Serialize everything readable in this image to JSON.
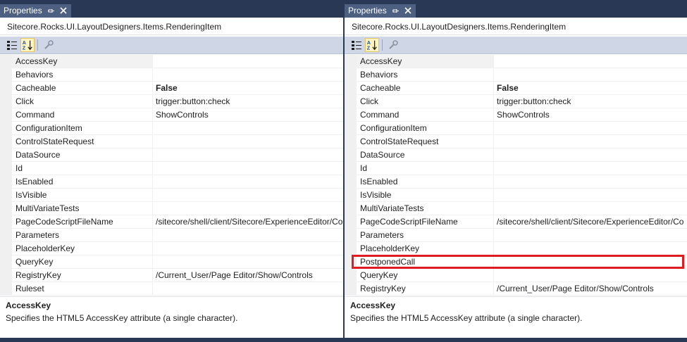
{
  "panel_title": "Properties",
  "object_name": "Sitecore.Rocks.UI.LayoutDesigners.Items.RenderingItem",
  "colors": {
    "window_bg": "#293955",
    "tab_bg": "#4d6082",
    "toolbar_bg": "#cfd6e5",
    "highlight": "#e01b24"
  },
  "icons": {
    "categorized": "categorized-icon",
    "alphabetical": "alphabetical-icon",
    "property_pages": "wrench-icon",
    "pin": "pin-icon",
    "close": "close-icon"
  },
  "left": {
    "rows": [
      {
        "name": "AccessKey",
        "value": ""
      },
      {
        "name": "Behaviors",
        "value": ""
      },
      {
        "name": "Cacheable",
        "value": "False"
      },
      {
        "name": "Click",
        "value": "trigger:button:check"
      },
      {
        "name": "Command",
        "value": "ShowControls"
      },
      {
        "name": "ConfigurationItem",
        "value": ""
      },
      {
        "name": "ControlStateRequest",
        "value": ""
      },
      {
        "name": "DataSource",
        "value": ""
      },
      {
        "name": "Id",
        "value": ""
      },
      {
        "name": "IsEnabled",
        "value": ""
      },
      {
        "name": "IsVisible",
        "value": ""
      },
      {
        "name": "MultiVariateTests",
        "value": ""
      },
      {
        "name": "PageCodeScriptFileName",
        "value": "/sitecore/shell/client/Sitecore/ExperienceEditor/Co"
      },
      {
        "name": "Parameters",
        "value": ""
      },
      {
        "name": "PlaceholderKey",
        "value": ""
      },
      {
        "name": "QueryKey",
        "value": ""
      },
      {
        "name": "RegistryKey",
        "value": "/Current_User/Page Editor/Show/Controls"
      },
      {
        "name": "Ruleset",
        "value": ""
      }
    ]
  },
  "right": {
    "rows": [
      {
        "name": "AccessKey",
        "value": ""
      },
      {
        "name": "Behaviors",
        "value": ""
      },
      {
        "name": "Cacheable",
        "value": "False"
      },
      {
        "name": "Click",
        "value": "trigger:button:check"
      },
      {
        "name": "Command",
        "value": "ShowControls"
      },
      {
        "name": "ConfigurationItem",
        "value": ""
      },
      {
        "name": "ControlStateRequest",
        "value": ""
      },
      {
        "name": "DataSource",
        "value": ""
      },
      {
        "name": "Id",
        "value": ""
      },
      {
        "name": "IsEnabled",
        "value": ""
      },
      {
        "name": "IsVisible",
        "value": ""
      },
      {
        "name": "MultiVariateTests",
        "value": ""
      },
      {
        "name": "PageCodeScriptFileName",
        "value": "/sitecore/shell/client/Sitecore/ExperienceEditor/Co"
      },
      {
        "name": "Parameters",
        "value": ""
      },
      {
        "name": "PlaceholderKey",
        "value": ""
      },
      {
        "name": "PostponedCall",
        "value": ""
      },
      {
        "name": "QueryKey",
        "value": ""
      },
      {
        "name": "RegistryKey",
        "value": "/Current_User/Page Editor/Show/Controls"
      }
    ]
  },
  "description": {
    "title": "AccessKey",
    "text": "Specifies the HTML5 AccessKey attribute (a single character)."
  }
}
